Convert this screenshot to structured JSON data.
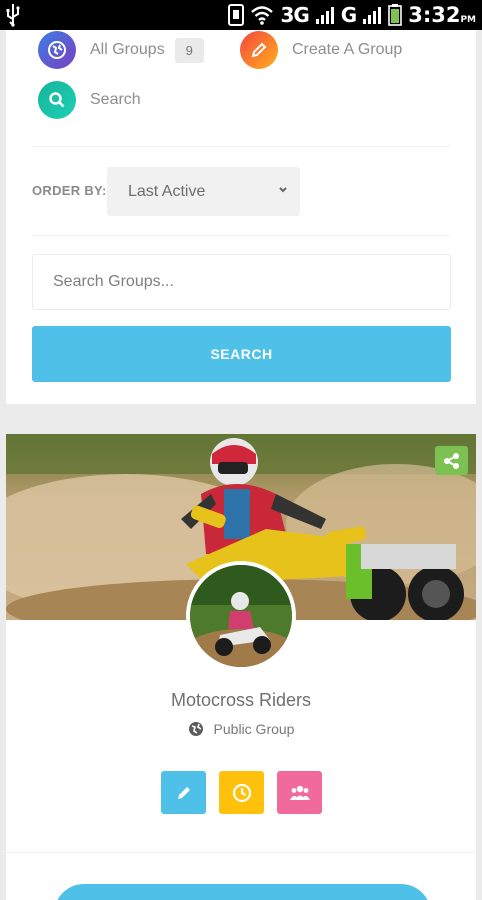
{
  "status_bar": {
    "network_1": "3G",
    "network_2": "G",
    "time": "3:32",
    "time_suffix": "PM"
  },
  "nav": {
    "all_groups_label": "All Groups",
    "all_groups_count": "9",
    "create_group_label": "Create A Group",
    "search_label": "Search"
  },
  "filter": {
    "order_by_label": "ORDER BY:",
    "order_by_value": "Last Active"
  },
  "search": {
    "placeholder": "Search Groups...",
    "button_label": "SEARCH"
  },
  "group": {
    "name": "Motocross Riders",
    "type": "Public Group"
  },
  "icons": {
    "all_groups": "globe-icon",
    "create_group": "pencil-icon",
    "search": "search-icon",
    "share": "share-icon",
    "edit": "pencil-icon",
    "activity": "clock-icon",
    "members": "members-icon"
  },
  "colors": {
    "primary": "#4fc0e8",
    "share_green": "#7ec153",
    "edit_blue": "#4fc0e8",
    "clock_yellow": "#ffc10b",
    "members_pink": "#f06a9b"
  }
}
